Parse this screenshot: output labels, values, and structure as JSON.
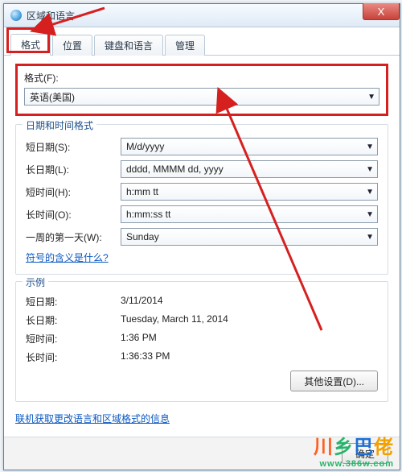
{
  "window": {
    "title": "区域和语言",
    "close": "X"
  },
  "tabs": [
    "格式",
    "位置",
    "键盘和语言",
    "管理"
  ],
  "format": {
    "label": "格式(F):",
    "value": "英语(美国)"
  },
  "datetime": {
    "legend": "日期和时间格式",
    "rows": [
      {
        "label": "短日期(S):",
        "value": "M/d/yyyy"
      },
      {
        "label": "长日期(L):",
        "value": "dddd, MMMM dd, yyyy"
      },
      {
        "label": "短时间(H):",
        "value": "h:mm tt"
      },
      {
        "label": "长时间(O):",
        "value": "h:mm:ss tt"
      },
      {
        "label": "一周的第一天(W):",
        "value": "Sunday"
      }
    ],
    "notationLink": "符号的含义是什么?"
  },
  "examples": {
    "legend": "示例",
    "rows": [
      {
        "label": "短日期:",
        "value": "3/11/2014"
      },
      {
        "label": "长日期:",
        "value": "Tuesday, March 11, 2014"
      },
      {
        "label": "短时间:",
        "value": "1:36 PM"
      },
      {
        "label": "长时间:",
        "value": "1:36:33 PM"
      }
    ],
    "otherSettings": "其他设置(D)..."
  },
  "onlineLink": "联机获取更改语言和区域格式的信息",
  "footer": {
    "ok": "确定"
  },
  "watermark": {
    "logo": "川乡巴佬",
    "url": "www.386w.com"
  }
}
